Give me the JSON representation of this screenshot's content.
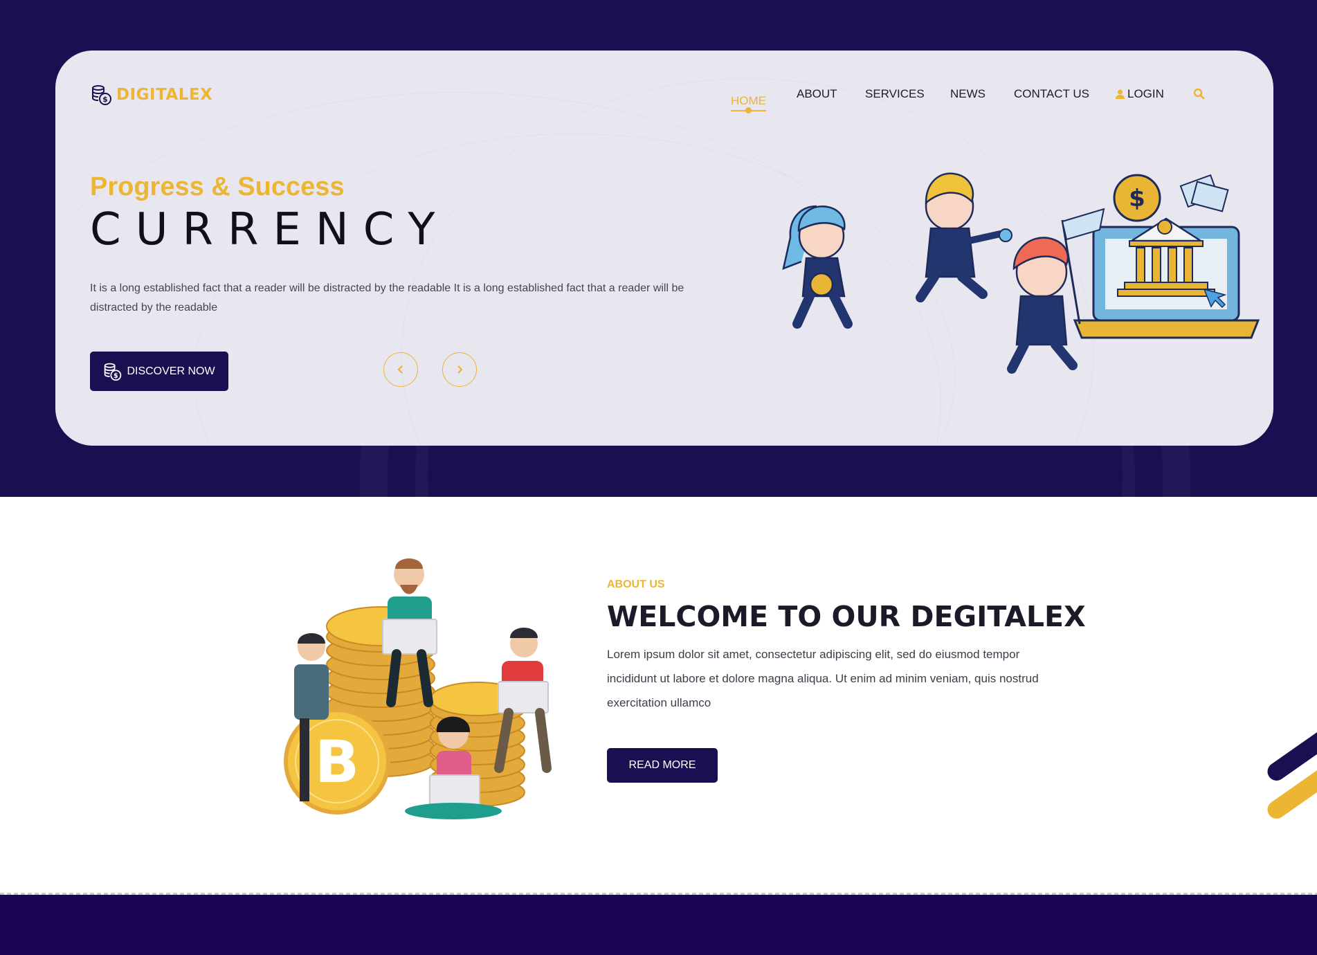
{
  "colors": {
    "brand_dark": "#1b0f52",
    "accent": "#ecb534",
    "hero_card": "#e8e7f0"
  },
  "brand": {
    "name": "DIGITALEX",
    "logo_icon": "coin-stack-icon"
  },
  "nav": {
    "items": [
      {
        "label": "HOME",
        "active": true
      },
      {
        "label": "ABOUT"
      },
      {
        "label": "SERVICES"
      },
      {
        "label": "NEWS"
      },
      {
        "label": "CONTACT US"
      },
      {
        "label": "LOGIN",
        "icon": "user-icon"
      }
    ],
    "search_icon": "search-icon"
  },
  "hero": {
    "kicker": "Progress & Success",
    "title": "CURRENCY",
    "description": "It is a long established fact that a reader will be distracted by the readable It is a long established fact that a reader will be distracted by the readable",
    "cta_label": "DISCOVER NOW",
    "prev_icon": "chevron-left-icon",
    "next_icon": "chevron-right-icon",
    "illustration": "businessmen-running-to-bank-laptop"
  },
  "about": {
    "kicker": "ABOUT US",
    "title": "WELCOME TO OUR DEGITALEX",
    "description": "Lorem ipsum dolor sit amet, consectetur adipiscing elit, sed do eiusmod tempor incididunt ut labore et dolore magna aliqua. Ut enim ad minim veniam, quis nostrud exercitation ullamco",
    "cta_label": "READ MORE",
    "illustration": "people-with-laptops-on-bitcoin-stacks"
  }
}
